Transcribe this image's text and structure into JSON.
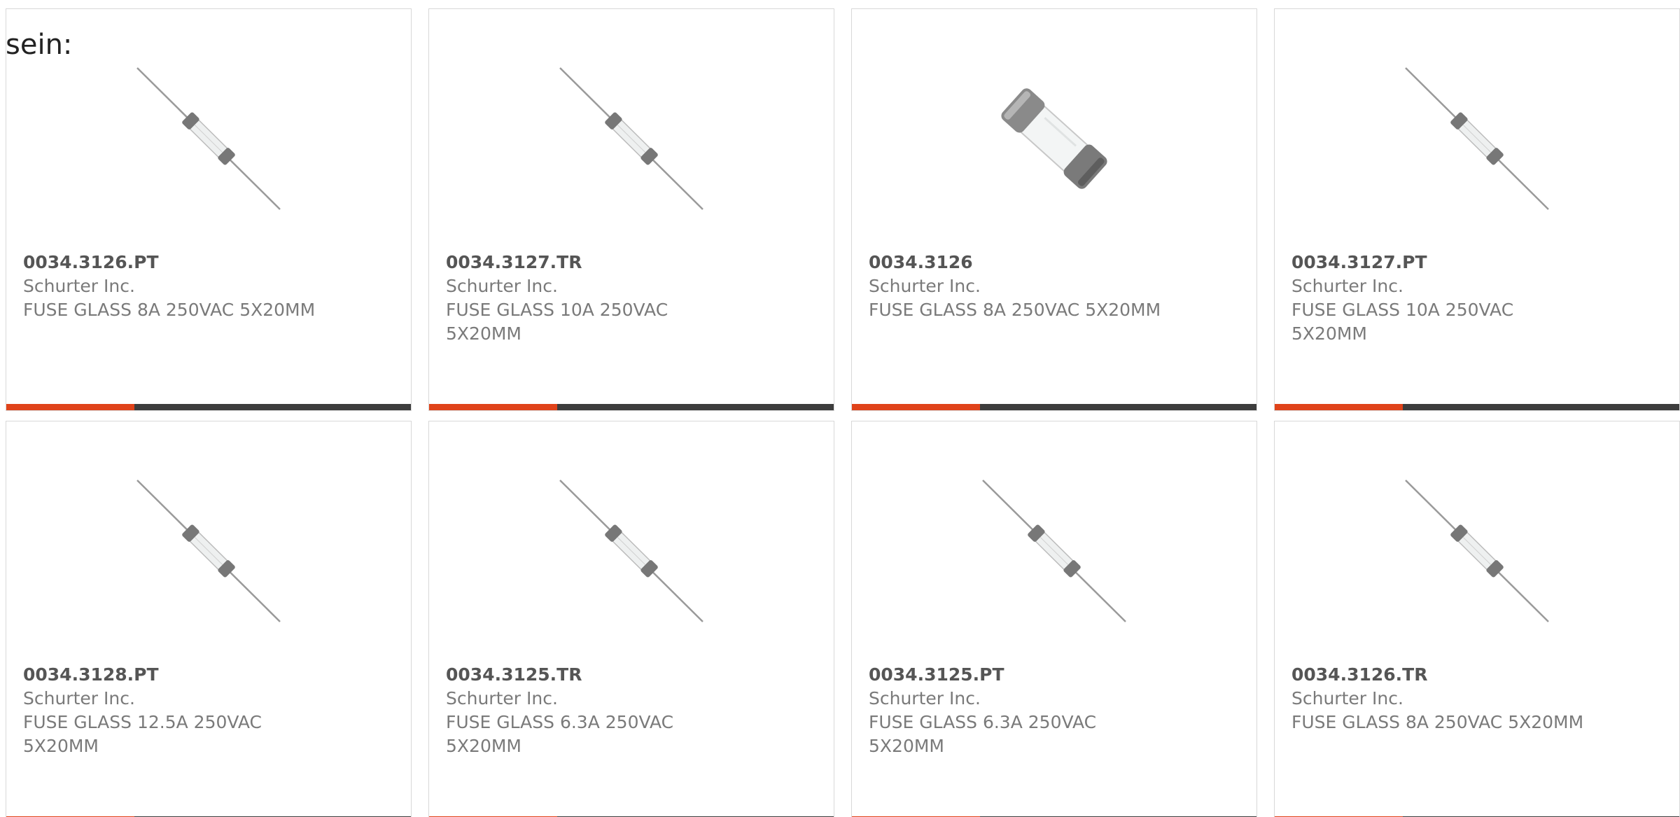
{
  "prefix_text": "sein:",
  "colors": {
    "accent_bar": "#e0431a",
    "dark_bar": "#3d3d3d",
    "part_number_text": "#555555",
    "body_text": "#7a7a7a"
  },
  "products": [
    {
      "part_number": "0034.3126.PT",
      "manufacturer": "Schurter Inc.",
      "description": "FUSE GLASS 8A 250VAC 5X20MM",
      "image_icon": "axial-lead-fuse-icon"
    },
    {
      "part_number": "0034.3127.TR",
      "manufacturer": "Schurter Inc.",
      "description": "FUSE GLASS 10A 250VAC 5X20MM",
      "image_icon": "axial-lead-fuse-icon"
    },
    {
      "part_number": "0034.3126",
      "manufacturer": "Schurter Inc.",
      "description": "FUSE GLASS 8A 250VAC 5X20MM",
      "image_icon": "cartridge-fuse-icon"
    },
    {
      "part_number": "0034.3127.PT",
      "manufacturer": "Schurter Inc.",
      "description": "FUSE GLASS 10A 250VAC 5X20MM",
      "image_icon": "axial-lead-fuse-icon"
    },
    {
      "part_number": "0034.3128.PT",
      "manufacturer": "Schurter Inc.",
      "description": "FUSE GLASS 12.5A 250VAC 5X20MM",
      "image_icon": "axial-lead-fuse-icon"
    },
    {
      "part_number": "0034.3125.TR",
      "manufacturer": "Schurter Inc.",
      "description": "FUSE GLASS 6.3A 250VAC 5X20MM",
      "image_icon": "axial-lead-fuse-icon"
    },
    {
      "part_number": "0034.3125.PT",
      "manufacturer": "Schurter Inc.",
      "description": "FUSE GLASS 6.3A 250VAC 5X20MM",
      "image_icon": "axial-lead-fuse-icon"
    },
    {
      "part_number": "0034.3126.TR",
      "manufacturer": "Schurter Inc.",
      "description": "FUSE GLASS 8A 250VAC 5X20MM",
      "image_icon": "axial-lead-fuse-icon"
    }
  ]
}
